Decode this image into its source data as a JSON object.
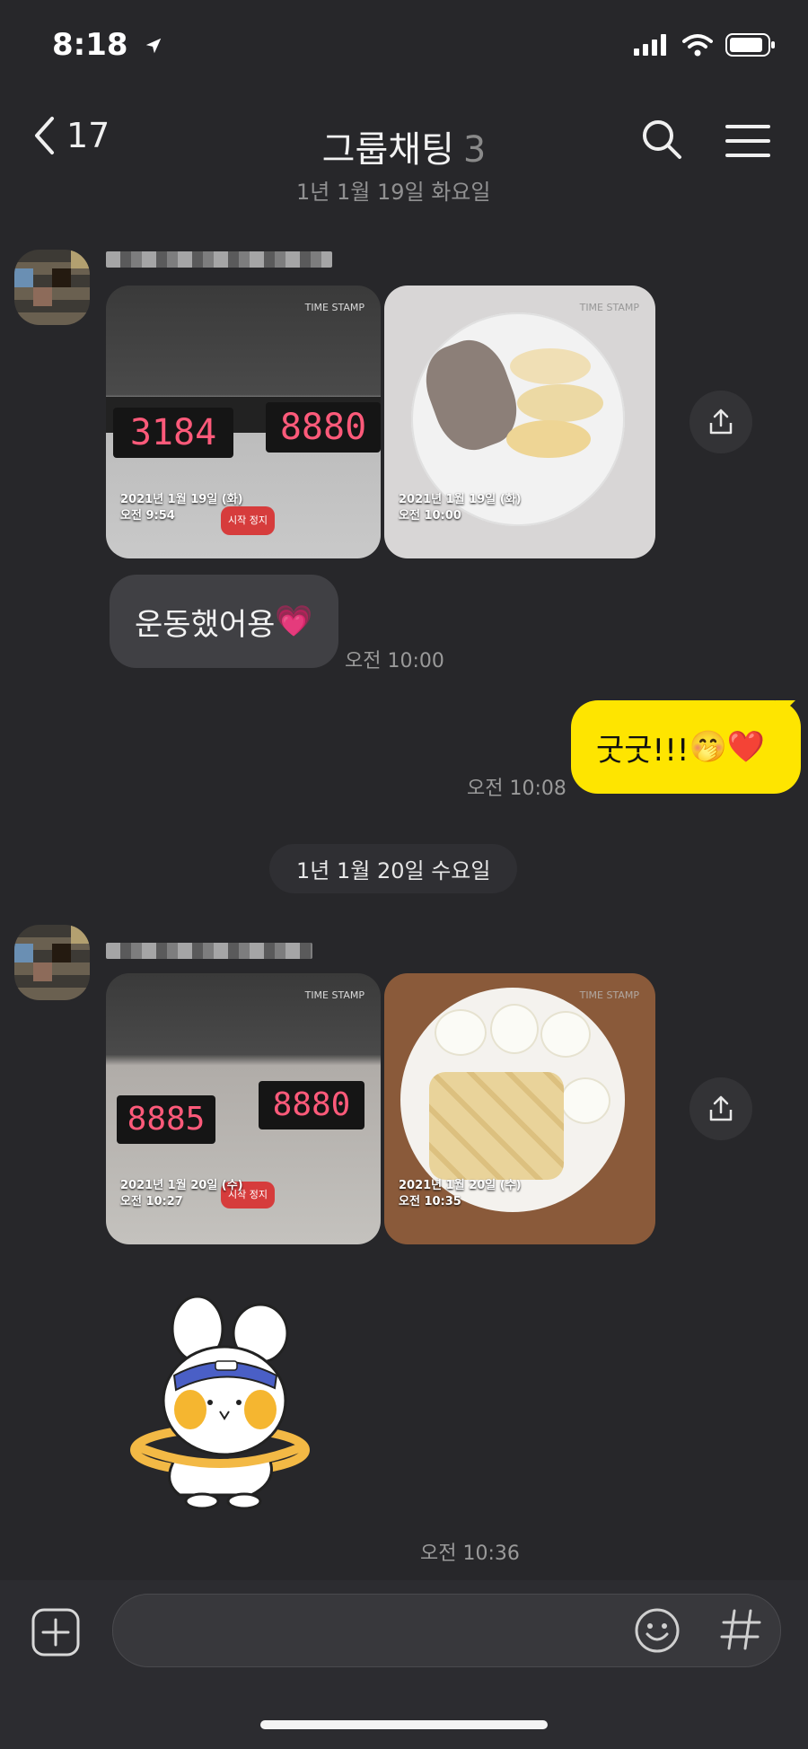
{
  "status_bar": {
    "time": "8:18"
  },
  "header": {
    "back_count": "17",
    "title": "그룹채팅",
    "member_count": "3"
  },
  "dates": {
    "d1": "1년 1월 19일 화요일",
    "d2": "1년 1월 20일 수요일"
  },
  "messages": {
    "m1": {
      "photos": [
        {
          "stamp": "TIME STAMP",
          "date": "2021년 1월 19일 (화)",
          "time": "오전 9:54",
          "display_a": "3184",
          "display_b": "8880",
          "btn": "시작 정지"
        },
        {
          "stamp": "TIME STAMP",
          "date": "2021년 1월 19일 (화)",
          "time": "오전 10:00"
        }
      ]
    },
    "m2": {
      "text": "운동했어용",
      "emoji": "💗",
      "time": "오전 10:00"
    },
    "m3": {
      "text": "굿굿!!!",
      "emoji": "🤭❤️",
      "time": "오전 10:08"
    },
    "m4": {
      "photos": [
        {
          "stamp": "TIME STAMP",
          "date": "2021년 1월 20일 (수)",
          "time": "오전 10:27",
          "display_a": "8885",
          "display_b": "8880",
          "btn": "시작 정지"
        },
        {
          "stamp": "TIME STAMP",
          "date": "2021년 1월 20일 (수)",
          "time": "오전 10:35"
        }
      ]
    },
    "m5": {
      "time": "오전 10:36"
    }
  },
  "colors": {
    "background": "#27272a",
    "incoming": "#404044",
    "outgoing": "#fee500"
  },
  "icons": [
    "back-chevron-icon",
    "search-icon",
    "menu-icon",
    "share-icon",
    "add-icon",
    "emoji-icon",
    "hashtag-icon"
  ]
}
